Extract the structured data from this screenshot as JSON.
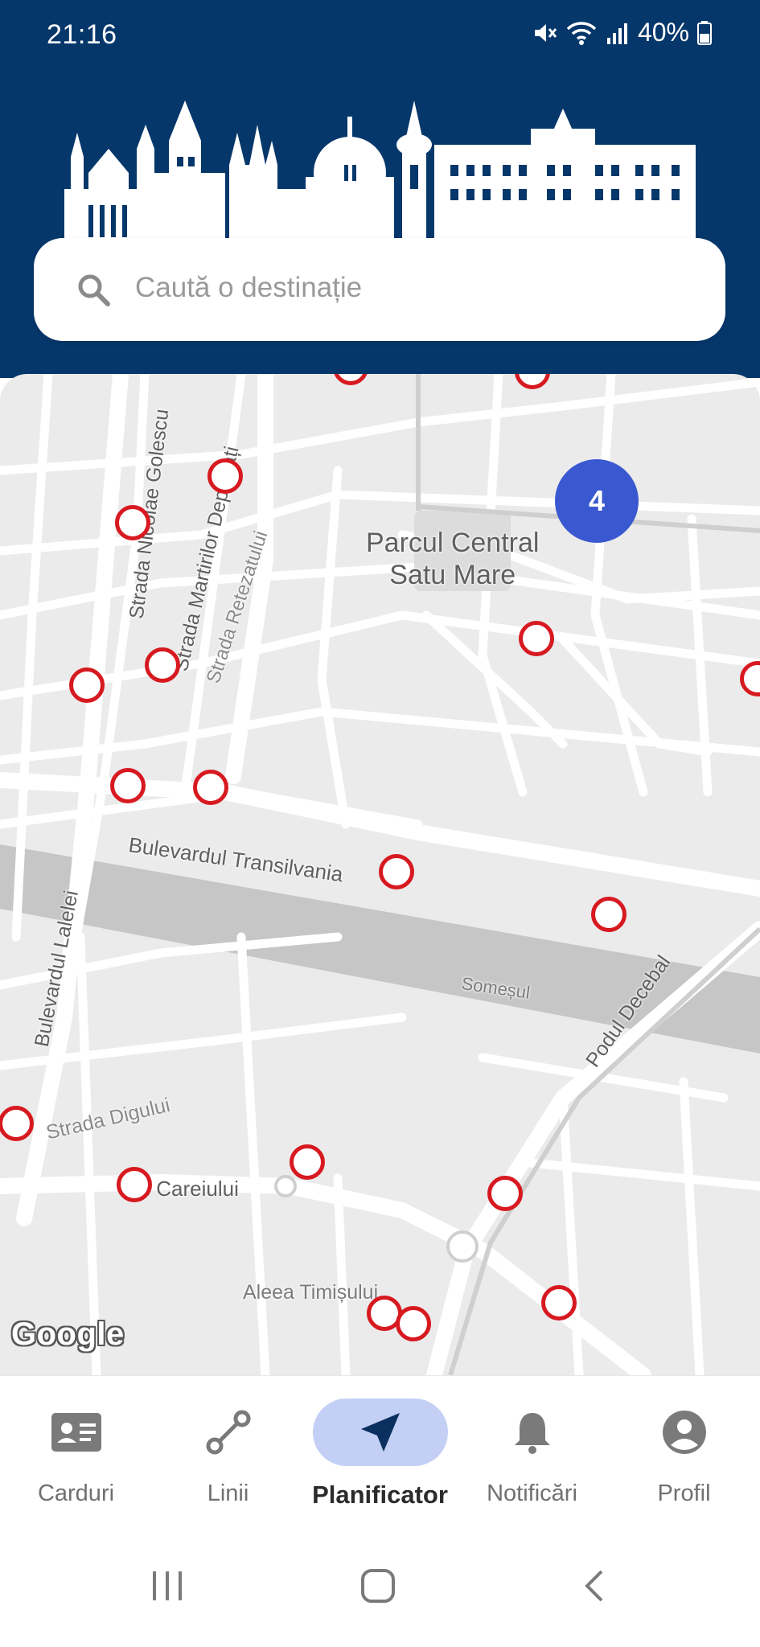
{
  "status": {
    "time": "21:16",
    "battery": "40%",
    "icons": [
      "mute-icon",
      "wifi-icon",
      "signal-icon",
      "battery-icon"
    ]
  },
  "search": {
    "placeholder": "Caută o destinație",
    "icon": "search-icon"
  },
  "map": {
    "labels": {
      "park": "Parcul Central\nSatu Mare",
      "park_line1": "Parcul Central",
      "park_line2": "Satu Mare",
      "golescu": "Strada Nicolae Golescu",
      "martirilor": "Strada Martirilor Deportați",
      "retezatului": "Strada Retezatului",
      "transilvania": "Bulevardul Transilvania",
      "lalelei": "Bulevardul Lalelei",
      "somesul": "Someșul",
      "decebal": "Podul Decebal",
      "digului": "Strada Digului",
      "careiului": "Str. Careiului",
      "timisului": "Aleea Timișului"
    },
    "cluster_count": "4",
    "attribution": "Google"
  },
  "nav": {
    "items": [
      {
        "label": "Carduri",
        "icon": "card-icon"
      },
      {
        "label": "Linii",
        "icon": "route-icon"
      },
      {
        "label": "Planificator",
        "icon": "navigation-arrow-icon"
      },
      {
        "label": "Notificări",
        "icon": "bell-icon"
      },
      {
        "label": "Profil",
        "icon": "account-icon"
      }
    ],
    "active": "Planificator"
  },
  "colors": {
    "header": "#06376b",
    "stop_marker": "#d71920",
    "cluster": "#3a58d0",
    "active_pill": "#c3cff5"
  }
}
